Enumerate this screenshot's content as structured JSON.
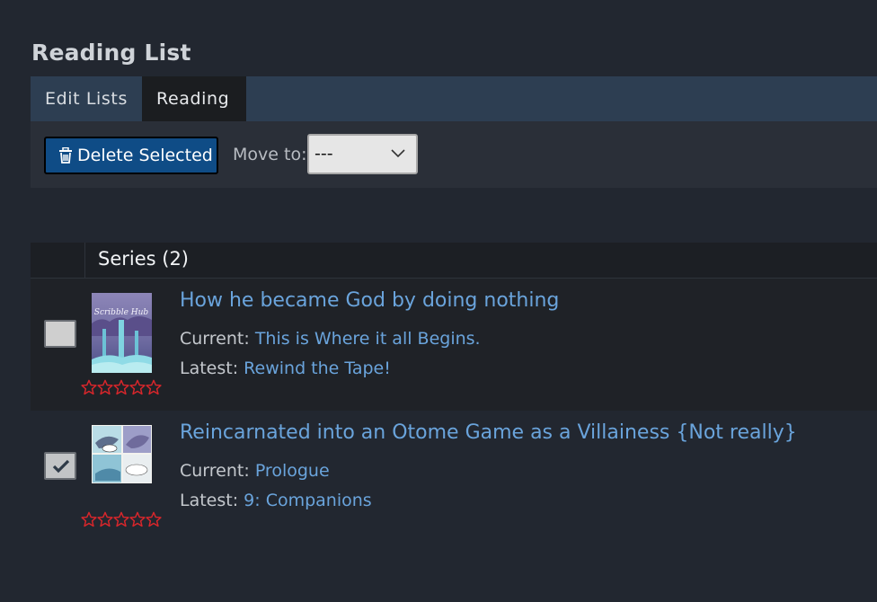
{
  "page": {
    "title": "Reading List"
  },
  "tabs": [
    {
      "label": "Edit Lists",
      "active": false
    },
    {
      "label": "Reading",
      "active": true
    }
  ],
  "actions": {
    "delete_label": "Delete Selected",
    "delete_icon": "trash-icon",
    "move_label": "Move to:",
    "move_value": "---"
  },
  "list": {
    "header": "Series (2)",
    "rows": [
      {
        "title": "How he became God by doing nothing",
        "checked": false,
        "current_label": "Current:",
        "current": "This is Where it all Begins.",
        "latest_label": "Latest:",
        "latest": "Rewind the Tape!",
        "rating": 0,
        "rating_max": 5,
        "cover_text": "Scribble Hub"
      },
      {
        "title": "Reincarnated into an Otome Game as a Villainess {Not really}",
        "checked": true,
        "current_label": "Current:",
        "current": "Prologue",
        "latest_label": "Latest:",
        "latest": "9: Companions",
        "rating": 0,
        "rating_max": 5
      }
    ]
  },
  "colors": {
    "background": "#222730",
    "tab_bar": "#2d3e52",
    "active_tab": "#1b1d20",
    "link": "#6aa4dc",
    "button": "#0f4c86",
    "star": "#d9262b"
  }
}
